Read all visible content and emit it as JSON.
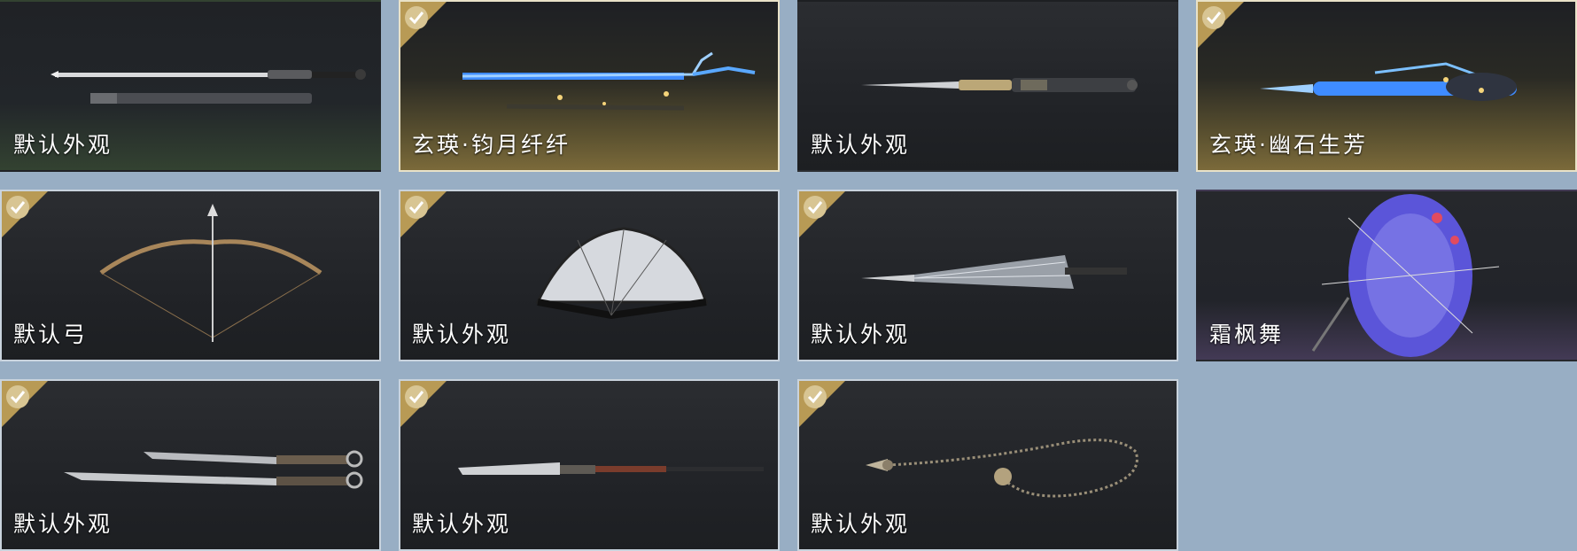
{
  "skins": [
    {
      "name": "默认外观",
      "owned": false,
      "weapon": "sword-with-scabbard"
    },
    {
      "name": "玄瑛·钧月纤纤",
      "owned": true,
      "weapon": "glowing-blue-sword"
    },
    {
      "name": "默认外观",
      "owned": false,
      "weapon": "ornate-sword"
    },
    {
      "name": "玄瑛·幽石生芳",
      "owned": true,
      "weapon": "glowing-blue-spear"
    },
    {
      "name": "默认弓",
      "owned": true,
      "weapon": "bow-and-arrow"
    },
    {
      "name": "默认外观",
      "owned": true,
      "weapon": "folding-fan"
    },
    {
      "name": "默认外观",
      "owned": true,
      "weapon": "closed-umbrella"
    },
    {
      "name": "霜枫舞",
      "owned": false,
      "weapon": "open-umbrella"
    },
    {
      "name": "默认外观",
      "owned": true,
      "weapon": "twin-blades"
    },
    {
      "name": "默认外观",
      "owned": true,
      "weapon": "glaive"
    },
    {
      "name": "默认外观",
      "owned": true,
      "weapon": "rope-dart"
    }
  ],
  "colors": {
    "background": "#98aec4",
    "check_badge": "#b89a55",
    "glow_blue": "#3f8cff"
  }
}
